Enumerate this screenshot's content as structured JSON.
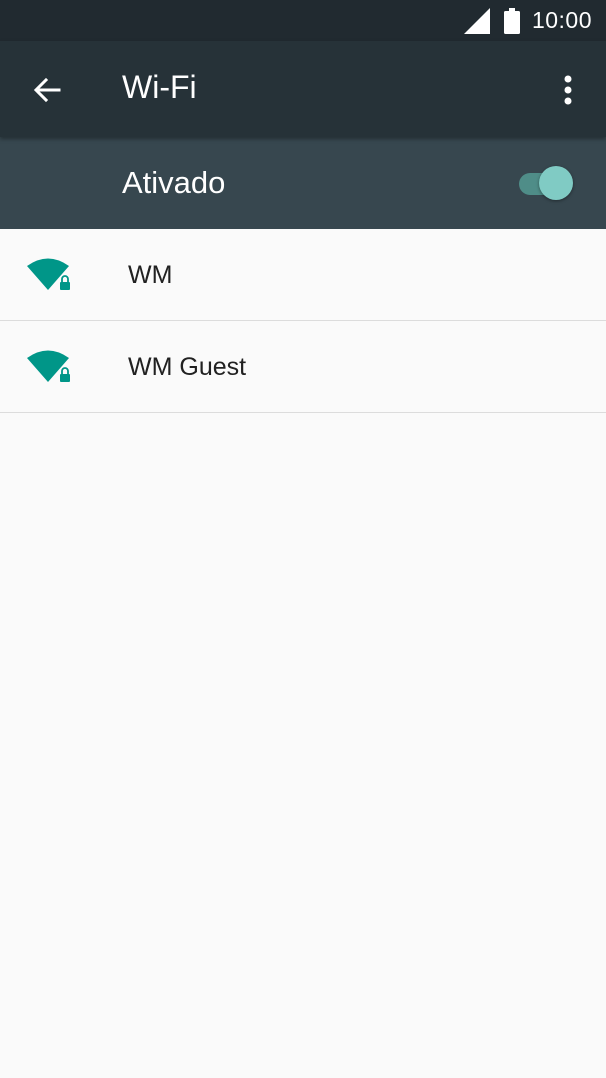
{
  "status_bar": {
    "time": "10:00",
    "icons": [
      "cell-signal-icon",
      "battery-icon"
    ]
  },
  "app_bar": {
    "title": "Wi-Fi",
    "back_icon": "arrow-back-icon",
    "overflow_icon": "more-vert-icon"
  },
  "master_switch": {
    "label": "Ativado",
    "state": "on"
  },
  "networks": [
    {
      "ssid": "WM",
      "secured": true,
      "icon": "wifi-lock-icon"
    },
    {
      "ssid": "WM Guest",
      "secured": true,
      "icon": "wifi-lock-icon"
    }
  ],
  "colors": {
    "status_bar": "#212a30",
    "app_bar": "#263238",
    "switch_bar": "#37474f",
    "accent": "#009688",
    "toggle_thumb": "#80cbc4",
    "toggle_track": "#4f8d88",
    "background": "#fafafa"
  }
}
